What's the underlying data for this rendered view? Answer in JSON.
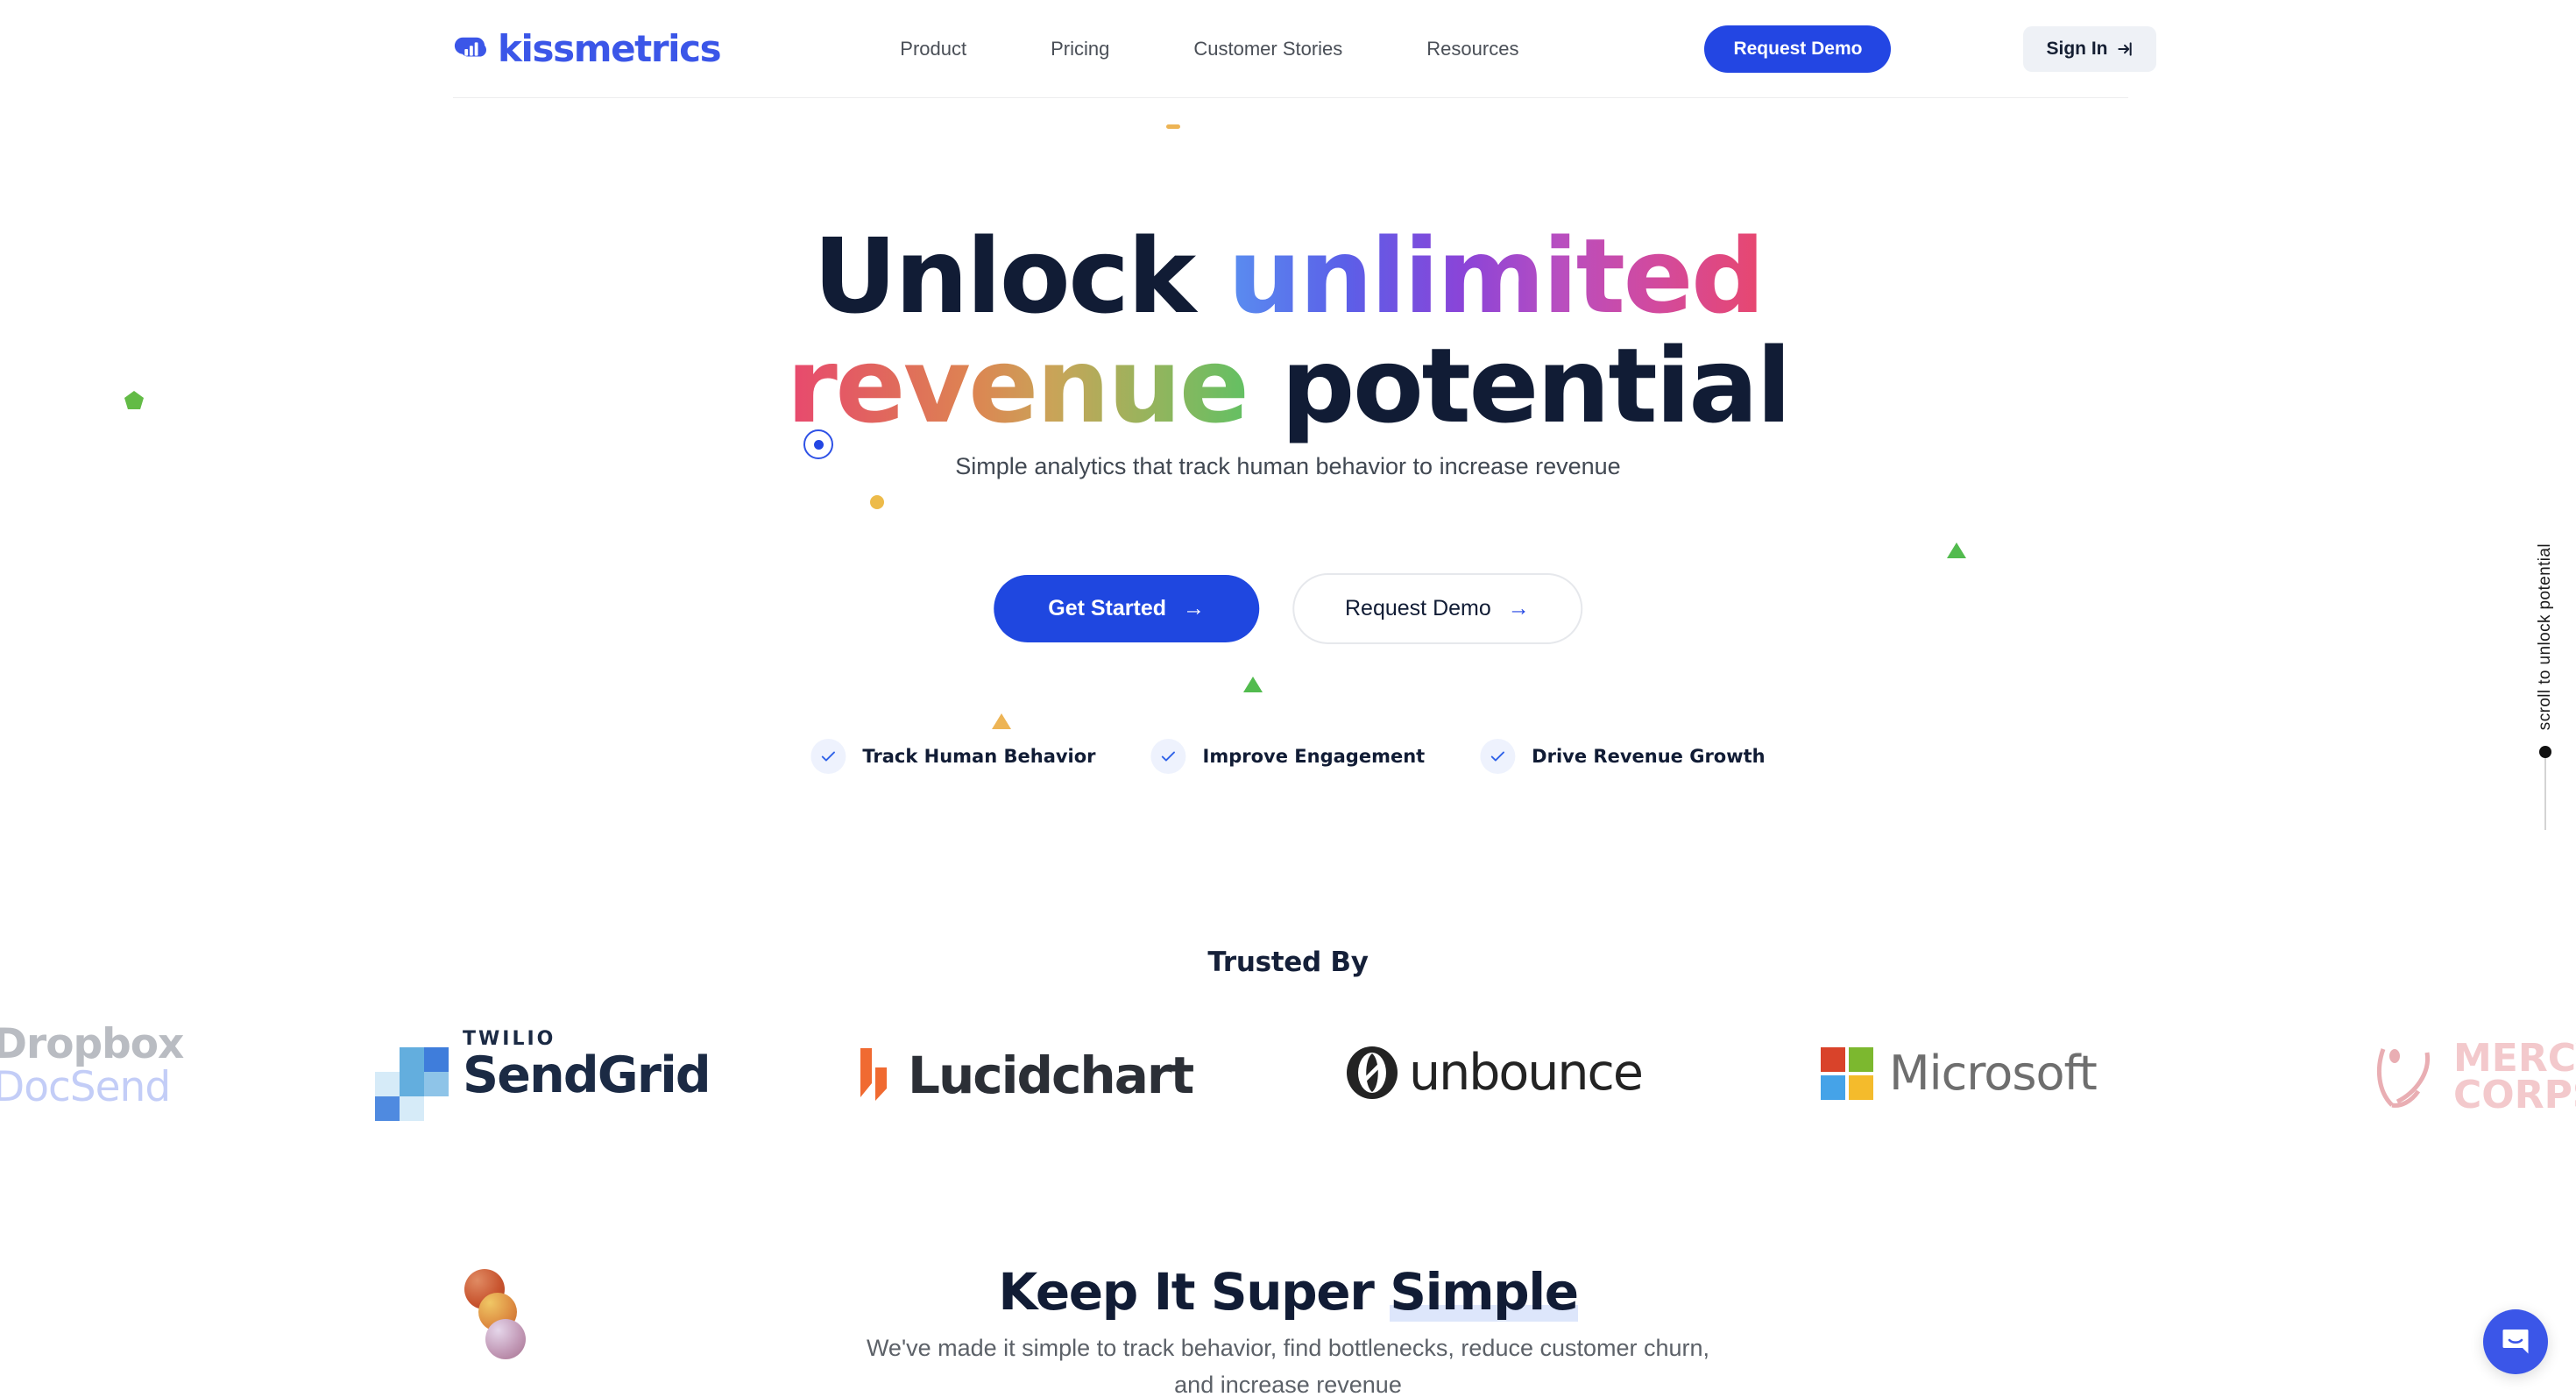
{
  "brand": {
    "name": "kissmetrics",
    "logo_icon": "bar-chart-cloud-icon",
    "accent_blue": "#3b56e8",
    "button_blue": "#2346e3",
    "dark_navy": "#111c35"
  },
  "nav": {
    "links": [
      {
        "label": "Product"
      },
      {
        "label": "Pricing"
      },
      {
        "label": "Customer Stories"
      },
      {
        "label": "Resources"
      }
    ],
    "request_demo_label": "Request Demo",
    "sign_in_label": "Sign In",
    "sign_in_icon": "login-arrow-icon"
  },
  "hero": {
    "headline_part1": "Unlock ",
    "headline_gradient1": "unlimited",
    "headline_gradient2": "revenue",
    "headline_part2": " potential",
    "subheadline": "Simple analytics that track human behavior to increase revenue",
    "primary_cta": "Get Started",
    "secondary_cta": "Request Demo",
    "arrow_icon": "arrow-right-icon",
    "features": [
      {
        "label": "Track Human Behavior",
        "icon": "check-icon"
      },
      {
        "label": "Improve Engagement",
        "icon": "check-icon"
      },
      {
        "label": "Drive Revenue Growth",
        "icon": "check-icon"
      }
    ]
  },
  "scroll_indicator": {
    "text": "scroll to unlock potential",
    "dot_color": "#111111"
  },
  "trusted": {
    "title": "Trusted By",
    "logos": [
      {
        "name": "Dropbox DocSend",
        "line1": "Dropbox",
        "line2": "DocSend"
      },
      {
        "name": "Twilio SendGrid",
        "eyebrow": "TWILIO",
        "wordmark": "SendGrid"
      },
      {
        "name": "Lucidchart",
        "wordmark": "Lucidchart"
      },
      {
        "name": "unbounce",
        "wordmark": "unbounce"
      },
      {
        "name": "Microsoft",
        "wordmark": "Microsoft"
      },
      {
        "name": "Mercy Corps",
        "line1": "MERCY",
        "line2": "CORPS"
      }
    ]
  },
  "kiss": {
    "title_plain": "Keep It Super ",
    "title_highlight": "Simple",
    "subtitle": "We've made it simple to track behavior, find bottlenecks, reduce customer churn, and increase revenue"
  },
  "chat": {
    "icon": "chat-bubble-icon",
    "color": "#3b56e8"
  },
  "decor": {
    "pentagon_green": "#63bb46",
    "ring_blue": "#2f52e6",
    "dot_yellow": "#edbb4a",
    "triangle_green": "#52bb4e",
    "triangle_orange": "#edb455",
    "dash_orange": "#edb455"
  }
}
